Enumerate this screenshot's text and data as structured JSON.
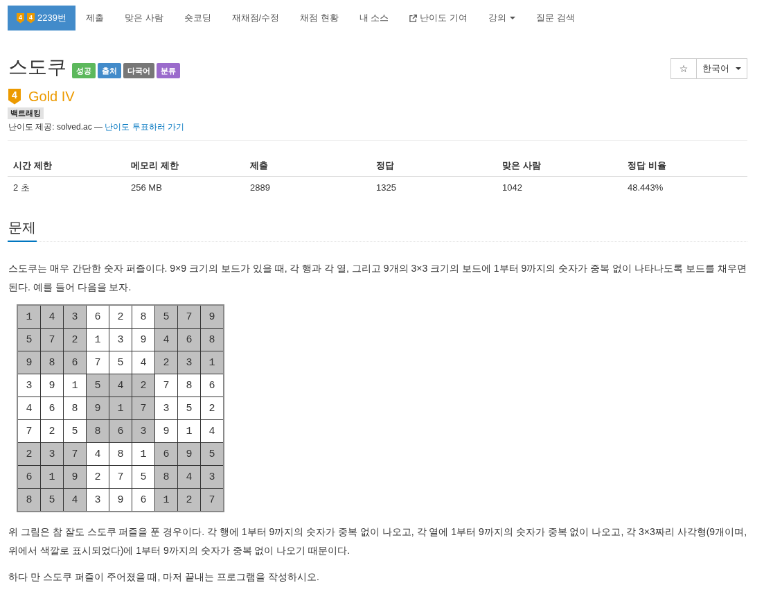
{
  "nav": {
    "items": [
      {
        "kind": "problem",
        "tier_marks": [
          "4",
          "4"
        ],
        "label": "2239번",
        "selected": true
      },
      {
        "kind": "link",
        "label": "제출",
        "selected": false
      },
      {
        "kind": "link",
        "label": "맞은 사람",
        "selected": false
      },
      {
        "kind": "link",
        "label": "숏코딩",
        "selected": false
      },
      {
        "kind": "link",
        "label": "재채점/수정",
        "selected": false
      },
      {
        "kind": "link",
        "label": "채점 현황",
        "selected": false
      },
      {
        "kind": "link",
        "label": "내 소스",
        "selected": false
      },
      {
        "kind": "external",
        "label": "난이도 기여",
        "selected": false
      },
      {
        "kind": "dropdown",
        "label": "강의",
        "selected": false
      },
      {
        "kind": "link",
        "label": "질문 검색",
        "selected": false
      }
    ]
  },
  "header": {
    "title": "스도쿠",
    "labels": [
      {
        "text": "성공",
        "color": "#5cb85c"
      },
      {
        "text": "출처",
        "color": "#428bca"
      },
      {
        "text": "다국어",
        "color": "#777777"
      },
      {
        "text": "분류",
        "color": "#9b6bcc"
      }
    ],
    "star_button": "☆",
    "language": "한국어"
  },
  "tier": {
    "mark": "4",
    "name": "Gold IV"
  },
  "tags": [
    "백트래킹"
  ],
  "difficulty_note": {
    "text": "난이도 제공: solved.ac — ",
    "link": "난이도 투표하러 가기"
  },
  "info_table": {
    "columns": [
      "시간 제한",
      "메모리 제한",
      "제출",
      "정답",
      "맞은 사람",
      "정답 비율"
    ],
    "rows": [
      [
        "2 초",
        "256 MB",
        "2889",
        "1325",
        "1042",
        "48.443%"
      ]
    ]
  },
  "problem": {
    "heading": "문제",
    "blocks": [
      {
        "kind": "paragraph",
        "text": "스도쿠는 매우 간단한 숫자 퍼즐이다. 9×9 크기의 보드가 있을 때, 각 행과 각 열, 그리고 9개의 3×3 크기의 보드에 1부터 9까지의 숫자가 중복 없이 나타나도록 보드를 채우면 된다. 예를 들어 다음을 보자."
      },
      {
        "kind": "sudoku",
        "rows": [
          [
            {
              "value": "1",
              "shaded": true
            },
            {
              "value": "4",
              "shaded": true
            },
            {
              "value": "3",
              "shaded": true
            },
            {
              "value": "6",
              "shaded": false
            },
            {
              "value": "2",
              "shaded": false
            },
            {
              "value": "8",
              "shaded": false
            },
            {
              "value": "5",
              "shaded": true
            },
            {
              "value": "7",
              "shaded": true
            },
            {
              "value": "9",
              "shaded": true
            }
          ],
          [
            {
              "value": "5",
              "shaded": true
            },
            {
              "value": "7",
              "shaded": true
            },
            {
              "value": "2",
              "shaded": true
            },
            {
              "value": "1",
              "shaded": false
            },
            {
              "value": "3",
              "shaded": false
            },
            {
              "value": "9",
              "shaded": false
            },
            {
              "value": "4",
              "shaded": true
            },
            {
              "value": "6",
              "shaded": true
            },
            {
              "value": "8",
              "shaded": true
            }
          ],
          [
            {
              "value": "9",
              "shaded": true
            },
            {
              "value": "8",
              "shaded": true
            },
            {
              "value": "6",
              "shaded": true
            },
            {
              "value": "7",
              "shaded": false
            },
            {
              "value": "5",
              "shaded": false
            },
            {
              "value": "4",
              "shaded": false
            },
            {
              "value": "2",
              "shaded": true
            },
            {
              "value": "3",
              "shaded": true
            },
            {
              "value": "1",
              "shaded": true
            }
          ],
          [
            {
              "value": "3",
              "shaded": false
            },
            {
              "value": "9",
              "shaded": false
            },
            {
              "value": "1",
              "shaded": false
            },
            {
              "value": "5",
              "shaded": true
            },
            {
              "value": "4",
              "shaded": true
            },
            {
              "value": "2",
              "shaded": true
            },
            {
              "value": "7",
              "shaded": false
            },
            {
              "value": "8",
              "shaded": false
            },
            {
              "value": "6",
              "shaded": false
            }
          ],
          [
            {
              "value": "4",
              "shaded": false
            },
            {
              "value": "6",
              "shaded": false
            },
            {
              "value": "8",
              "shaded": false
            },
            {
              "value": "9",
              "shaded": true
            },
            {
              "value": "1",
              "shaded": true
            },
            {
              "value": "7",
              "shaded": true
            },
            {
              "value": "3",
              "shaded": false
            },
            {
              "value": "5",
              "shaded": false
            },
            {
              "value": "2",
              "shaded": false
            }
          ],
          [
            {
              "value": "7",
              "shaded": false
            },
            {
              "value": "2",
              "shaded": false
            },
            {
              "value": "5",
              "shaded": false
            },
            {
              "value": "8",
              "shaded": true
            },
            {
              "value": "6",
              "shaded": true
            },
            {
              "value": "3",
              "shaded": true
            },
            {
              "value": "9",
              "shaded": false
            },
            {
              "value": "1",
              "shaded": false
            },
            {
              "value": "4",
              "shaded": false
            }
          ],
          [
            {
              "value": "2",
              "shaded": true
            },
            {
              "value": "3",
              "shaded": true
            },
            {
              "value": "7",
              "shaded": true
            },
            {
              "value": "4",
              "shaded": false
            },
            {
              "value": "8",
              "shaded": false
            },
            {
              "value": "1",
              "shaded": false
            },
            {
              "value": "6",
              "shaded": true
            },
            {
              "value": "9",
              "shaded": true
            },
            {
              "value": "5",
              "shaded": true
            }
          ],
          [
            {
              "value": "6",
              "shaded": true
            },
            {
              "value": "1",
              "shaded": true
            },
            {
              "value": "9",
              "shaded": true
            },
            {
              "value": "2",
              "shaded": false
            },
            {
              "value": "7",
              "shaded": false
            },
            {
              "value": "5",
              "shaded": false
            },
            {
              "value": "8",
              "shaded": true
            },
            {
              "value": "4",
              "shaded": true
            },
            {
              "value": "3",
              "shaded": true
            }
          ],
          [
            {
              "value": "8",
              "shaded": true
            },
            {
              "value": "5",
              "shaded": true
            },
            {
              "value": "4",
              "shaded": true
            },
            {
              "value": "3",
              "shaded": false
            },
            {
              "value": "9",
              "shaded": false
            },
            {
              "value": "6",
              "shaded": false
            },
            {
              "value": "1",
              "shaded": true
            },
            {
              "value": "2",
              "shaded": true
            },
            {
              "value": "7",
              "shaded": true
            }
          ]
        ]
      },
      {
        "kind": "paragraph",
        "text": "위 그림은 참 잘도 스도쿠 퍼즐을 푼 경우이다. 각 행에 1부터 9까지의 숫자가 중복 없이 나오고, 각 열에 1부터 9까지의 숫자가 중복 없이 나오고, 각 3×3짜리 사각형(9개이며, 위에서 색깔로 표시되었다)에 1부터 9까지의 숫자가 중복 없이 나오기 때문이다."
      },
      {
        "kind": "paragraph",
        "text": "하다 만 스도쿠 퍼즐이 주어졌을 때, 마저 끝내는 프로그램을 작성하시오."
      }
    ]
  }
}
